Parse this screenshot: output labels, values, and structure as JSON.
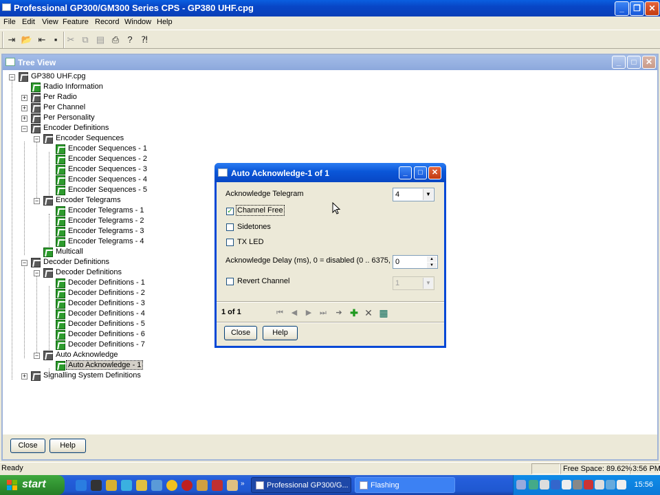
{
  "app": {
    "title": "Professional GP300/GM300 Series CPS - GP380 UHF.cpg",
    "menu": [
      "File",
      "Edit",
      "View",
      "Feature",
      "Record",
      "Window",
      "Help"
    ]
  },
  "toolbar": {
    "icons": [
      "read-radio-icon",
      "open-icon",
      "write-radio-icon",
      "save-icon",
      "cut-icon",
      "copy-icon",
      "paste-icon",
      "print-icon",
      "help-icon",
      "context-help-icon"
    ]
  },
  "tree_view": {
    "title": "Tree View",
    "root": "GP380 UHF.cpg",
    "nodes": {
      "radio_information": "Radio Information",
      "per_radio": "Per Radio",
      "per_channel": "Per Channel",
      "per_personality": "Per Personality",
      "encoder_definitions": "Encoder Definitions",
      "encoder_sequences": "Encoder Sequences",
      "encoder_sequence_items": [
        "Encoder Sequences - 1",
        "Encoder Sequences - 2",
        "Encoder Sequences - 3",
        "Encoder Sequences - 4",
        "Encoder Sequences - 5"
      ],
      "encoder_telegrams": "Encoder Telegrams",
      "encoder_telegram_items": [
        "Encoder Telegrams - 1",
        "Encoder Telegrams - 2",
        "Encoder Telegrams - 3",
        "Encoder Telegrams - 4"
      ],
      "multicall": "Multicall",
      "decoder_definitions": "Decoder Definitions",
      "decoder_definitions_sub": "Decoder Definitions",
      "decoder_definition_items": [
        "Decoder Definitions - 1",
        "Decoder Definitions - 2",
        "Decoder Definitions - 3",
        "Decoder Definitions - 4",
        "Decoder Definitions - 5",
        "Decoder Definitions - 6",
        "Decoder Definitions - 7"
      ],
      "auto_acknowledge": "Auto Acknowledge",
      "auto_acknowledge_item": "Auto Acknowledge - 1",
      "signalling_system_definitions": "Signalling System Definitions"
    },
    "close_label": "Close",
    "help_label": "Help"
  },
  "dialog": {
    "title": "Auto Acknowledge-1 of 1",
    "acknowledge_telegram_label": "Acknowledge Telegram",
    "acknowledge_telegram_value": "4",
    "channel_free_label": "Channel Free",
    "channel_free_checked": true,
    "sidetones_label": "Sidetones",
    "sidetones_checked": false,
    "tx_led_label": "TX LED",
    "tx_led_checked": false,
    "ack_delay_label": "Acknowledge Delay (ms), 0 = disabled (0 .. 6375, 25)",
    "ack_delay_value": "0",
    "revert_channel_label": "Revert Channel",
    "revert_channel_checked": false,
    "revert_channel_value": "1",
    "record_position": "1 of 1",
    "close_label": "Close",
    "help_label": "Help"
  },
  "status": {
    "text": "Ready",
    "free_space": "Free Space: 89.62%",
    "time": "3:56 PM"
  },
  "taskbar": {
    "start_label": "start",
    "tasks": [
      "Professional GP300/G...",
      "Flashing"
    ],
    "clock": "15:56"
  },
  "colors": {
    "xp_blue": "#0a56d8",
    "close_red": "#c23a10",
    "start_green": "#2f8f2f",
    "tree_icon_green": "#2d9b2d"
  }
}
